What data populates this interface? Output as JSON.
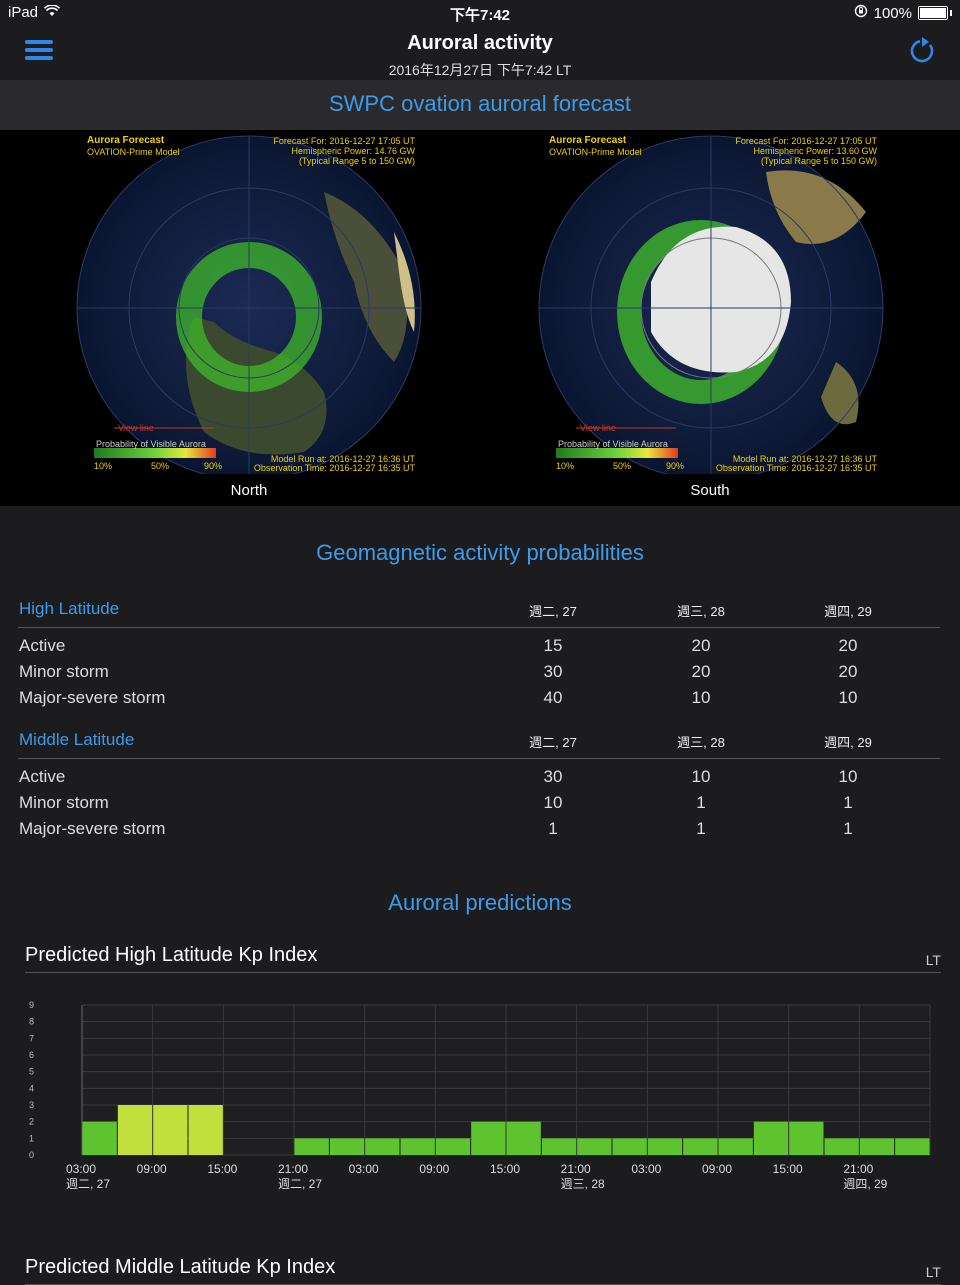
{
  "status_bar": {
    "device": "iPad",
    "time": "下午7:42",
    "battery": "100%"
  },
  "nav": {
    "title": "Auroral activity",
    "subtitle": "2016年12月27日 下午7:42 LT"
  },
  "forecast": {
    "title": "SWPC ovation auroral forecast",
    "north": {
      "label": "North",
      "heading": "Aurora Forecast",
      "model": "OVATION-Prime Model",
      "forecast_for": "Forecast For: 2016-12-27 17:05 UT",
      "power": "Hemispheric Power: 14.76 GW",
      "range": "(Typical Range 5 to 150 GW)",
      "view_line": "View line",
      "prob_label": "Probability of Visible Aurora",
      "scale": [
        "10%",
        "50%",
        "90%"
      ],
      "model_run": "Model Run at: 2016-12-27 16:36 UT",
      "obs_time": "Observation Time: 2016-12-27 16:35 UT"
    },
    "south": {
      "label": "South",
      "heading": "Aurora Forecast",
      "model": "OVATION-Prime Model",
      "forecast_for": "Forecast For: 2016-12-27 17:05 UT",
      "power": "Hemispheric Power: 13.60 GW",
      "range": "(Typical Range 5 to 150 GW)",
      "view_line": "View line",
      "prob_label": "Probability of Visible Aurora",
      "scale": [
        "10%",
        "50%",
        "90%"
      ],
      "model_run": "Model Run at: 2016-12-27 16:36 UT",
      "obs_time": "Observation Time: 2016-12-27 16:35 UT"
    }
  },
  "geomagnetic": {
    "title": "Geomagnetic activity probabilities",
    "high": {
      "heading": "High Latitude",
      "days": [
        "週二, 27",
        "週三, 28",
        "週四, 29"
      ],
      "rows": [
        {
          "label": "Active",
          "values": [
            "15",
            "20",
            "20"
          ]
        },
        {
          "label": "Minor storm",
          "values": [
            "30",
            "20",
            "20"
          ]
        },
        {
          "label": "Major-severe storm",
          "values": [
            "40",
            "10",
            "10"
          ]
        }
      ]
    },
    "middle": {
      "heading": "Middle Latitude",
      "days": [
        "週二, 27",
        "週三, 28",
        "週四, 29"
      ],
      "rows": [
        {
          "label": "Active",
          "values": [
            "30",
            "10",
            "10"
          ]
        },
        {
          "label": "Minor storm",
          "values": [
            "10",
            "1",
            "1"
          ]
        },
        {
          "label": "Major-severe storm",
          "values": [
            "1",
            "1",
            "1"
          ]
        }
      ]
    }
  },
  "predictions": {
    "title": "Auroral predictions",
    "high_chart_title": "Predicted High Latitude Kp Index",
    "middle_chart_title": "Predicted Middle Latitude Kp Index",
    "tz_label": "LT"
  },
  "chart_data": {
    "type": "bar",
    "title": "Predicted High Latitude Kp Index",
    "ylim": [
      0,
      9
    ],
    "yticks": [
      "0",
      "1",
      "2",
      "3",
      "4",
      "5",
      "6",
      "7",
      "8",
      "9"
    ],
    "values": [
      2,
      3,
      3,
      3,
      null,
      null,
      1,
      1,
      1,
      1,
      1,
      2,
      2,
      1,
      1,
      1,
      1,
      1,
      1,
      2,
      2,
      1,
      1,
      1
    ],
    "xtick_labels": [
      "03:00",
      "09:00",
      "15:00",
      "21:00",
      "03:00",
      "09:00",
      "15:00",
      "21:00",
      "03:00",
      "09:00",
      "15:00",
      "21:00"
    ],
    "date_labels": [
      {
        "after_tick": 0,
        "text": "週二, 27"
      },
      {
        "after_tick": 3,
        "text": "週二, 27"
      },
      {
        "after_tick": 7,
        "text": "週三, 28"
      },
      {
        "after_tick": 11,
        "text": "週四, 29"
      }
    ],
    "colors": {
      "low": "#5fc22f",
      "mid": "#c2df3c",
      "grid": "#3a3a3a"
    }
  }
}
